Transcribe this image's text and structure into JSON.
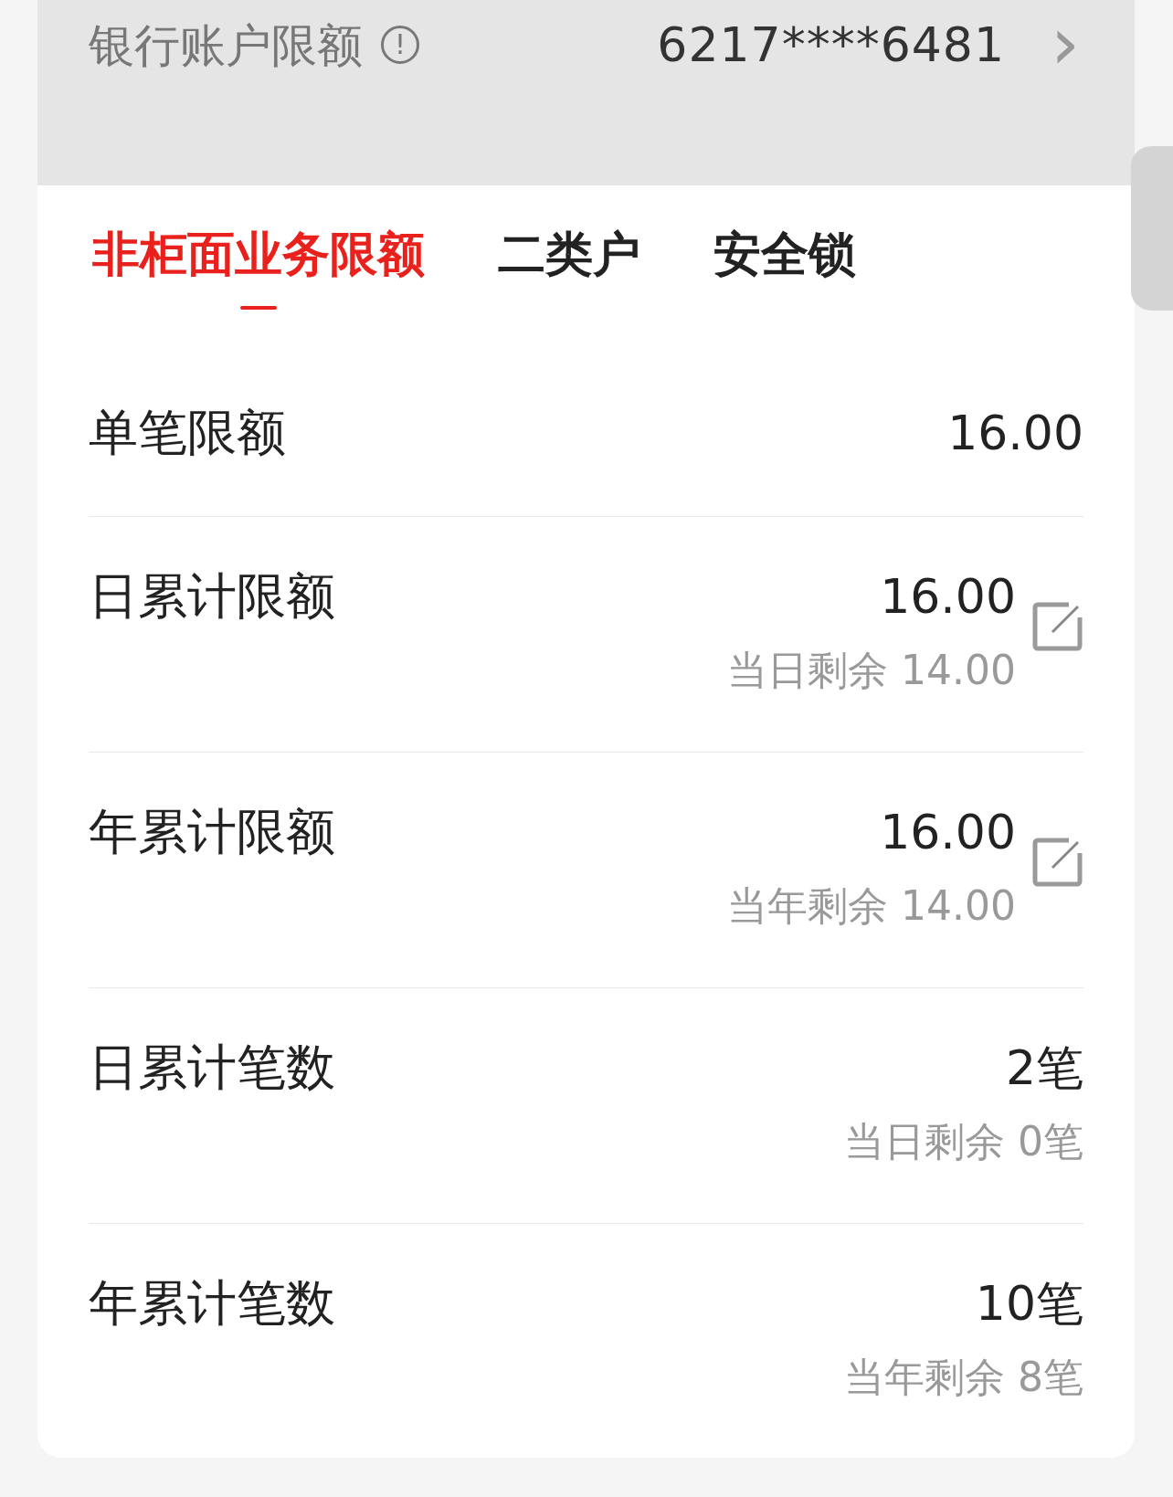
{
  "header": {
    "label": "银行账户限额",
    "info_icon": "!",
    "account": "6217****6481",
    "chevron": "›"
  },
  "tabs": [
    {
      "label": "非柜面业务限额",
      "selected": true
    },
    {
      "label": "二类户",
      "selected": false
    },
    {
      "label": "安全锁",
      "selected": false
    }
  ],
  "rows": [
    {
      "label": "单笔限额",
      "value": "16.00",
      "editable": false
    },
    {
      "label": "日累计限额",
      "value": "16.00",
      "remaining": "当日剩余 14.00",
      "editable": true
    },
    {
      "label": "年累计限额",
      "value": "16.00",
      "remaining": "当年剩余 14.00",
      "editable": true
    },
    {
      "label": "日累计笔数",
      "value": "2笔",
      "remaining": "当日剩余 0笔",
      "editable": false
    },
    {
      "label": "年累计笔数",
      "value": "10笔",
      "remaining": "当年剩余 8笔",
      "editable": false
    }
  ]
}
